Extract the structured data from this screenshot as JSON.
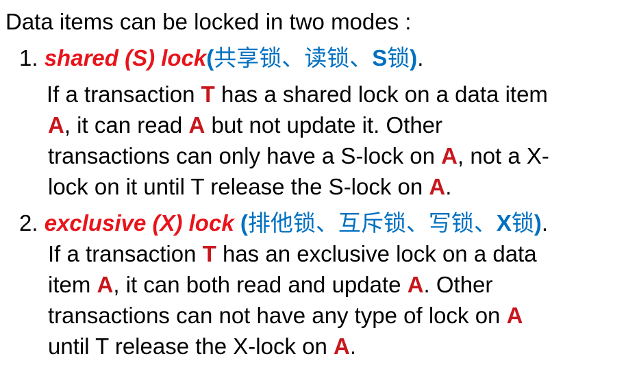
{
  "intro": "Data items can be locked in two modes :",
  "item1": {
    "number": "1.",
    "term": "shared (S) lock",
    "open_paren": "(",
    "cn_names": "共享锁、读锁、",
    "short_letter": "S",
    "short_suffix": "锁",
    "close_paren": ")",
    "period": ".",
    "desc": {
      "l1_a": "If a  transaction ",
      "l1_T": "T",
      "l1_b": " has a shared lock on a data item",
      "l2_A": "A",
      "l2_b": ", it can read ",
      "l2_A2": "A",
      "l2_c": " but not update it. Other",
      "l3_a": "transactions can only have a S-lock on ",
      "l3_A": "A",
      "l3_b": ", not a X-",
      "l4_a": "lock on it until T release the S-lock on ",
      "l4_A": "A",
      "l4_b": "."
    }
  },
  "item2": {
    "number": "2.",
    "term": "exclusive (X) lock",
    "space": " ",
    "open_paren": "(",
    "cn_names": "排他锁、互斥锁、写锁、",
    "short_letter": "X",
    "short_suffix": "锁",
    "close_paren": ")",
    "period": ".",
    "desc": {
      "l1_a": "If a transaction ",
      "l1_T": "T",
      "l1_b": " has an exclusive lock on a data",
      "l2_a": "item ",
      "l2_A": "A",
      "l2_b": ", it can both read and update ",
      "l2_A2": "A",
      "l2_c": ". Other",
      "l3_a": "transactions can not have any type of lock on ",
      "l3_A": "A",
      "l4_a": "until T release the X-lock on ",
      "l4_A": "A",
      "l4_b": "."
    }
  },
  "colors": {
    "term_red": "#e8141b",
    "highlight_red": "#c8161d",
    "chinese_blue": "#0070c0",
    "text": "#000000"
  }
}
